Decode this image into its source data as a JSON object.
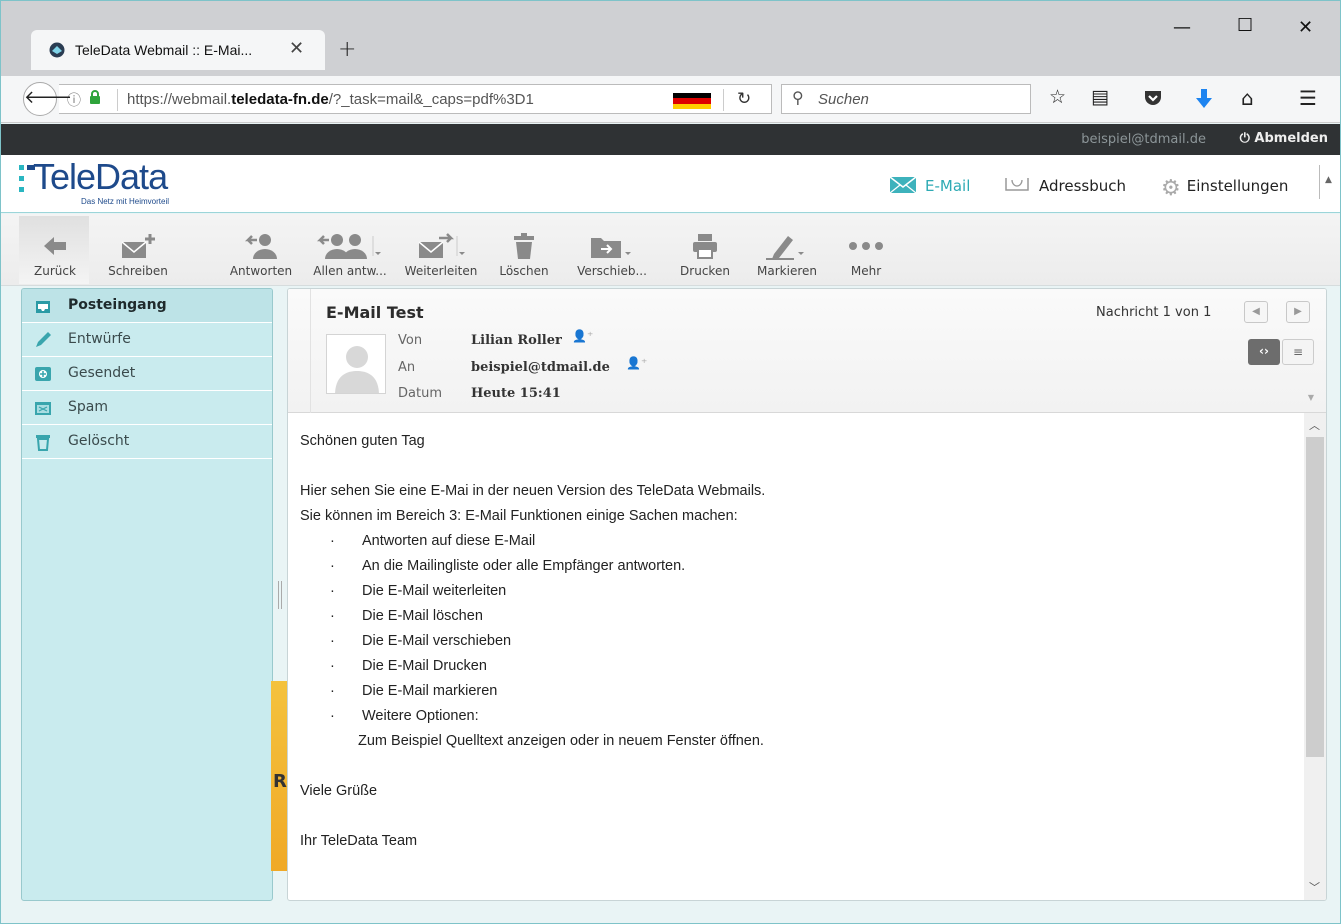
{
  "browser": {
    "tab_title": "TeleData Webmail :: E-Mai...",
    "url_prefix": "https://webmail.",
    "url_domain": "teledata-fn.de",
    "url_path": "/?_task=mail&_caps=pdf%3D1",
    "search_placeholder": "Suchen"
  },
  "topline": {
    "user": "beispiel@tdmail.de",
    "logout": "Abmelden"
  },
  "logo": {
    "text": "TeleData",
    "tagline": "Das Netz mit Heimvorteil"
  },
  "topnav": {
    "mail": "E-Mail",
    "addressbook": "Adressbuch",
    "settings": "Einstellungen"
  },
  "toolbar": {
    "back": "Zurück",
    "compose": "Schreiben",
    "reply": "Antworten",
    "reply_all": "Allen antw...",
    "forward": "Weiterleiten",
    "delete": "Löschen",
    "move": "Verschieb...",
    "print": "Drucken",
    "mark": "Markieren",
    "more": "Mehr"
  },
  "folders": [
    {
      "label": "Posteingang"
    },
    {
      "label": "Entwürfe"
    },
    {
      "label": "Gesendet"
    },
    {
      "label": "Spam"
    },
    {
      "label": "Gelöscht"
    }
  ],
  "message": {
    "subject": "E-Mail Test",
    "count": "Nachricht 1 von 1",
    "from_label": "Von",
    "from_value": "Lilian Roller",
    "to_label": "An",
    "to_value": "beispiel@tdmail.de",
    "date_label": "Datum",
    "date_value": "Heute 15:41",
    "body": {
      "greeting": "Schönen guten Tag",
      "line1": "Hier sehen Sie eine E-Mai in der neuen Version des TeleData Webmails.",
      "line2": "Sie können im Bereich 3: E-Mail Funktionen einige Sachen machen:",
      "bullets": [
        "Antworten auf diese E-Mail",
        "An die Mailingliste oder alle Empfänger antworten.",
        "Die E-Mail weiterleiten",
        "Die E-Mail löschen",
        "Die E-Mail verschieben",
        "Die E-Mail Drucken",
        "Die E-Mail markieren",
        "Weitere Optionen:"
      ],
      "bullet_cont": "Zum Beispiel Quelltext anzeigen oder in neuem Fenster öffnen.",
      "closing": "Viele Grüße",
      "signature": "Ihr TeleData Team"
    }
  },
  "colors": {
    "accent": "#3db2bc",
    "folder_bg": "#c9ebee",
    "topline": "#2f3234"
  }
}
